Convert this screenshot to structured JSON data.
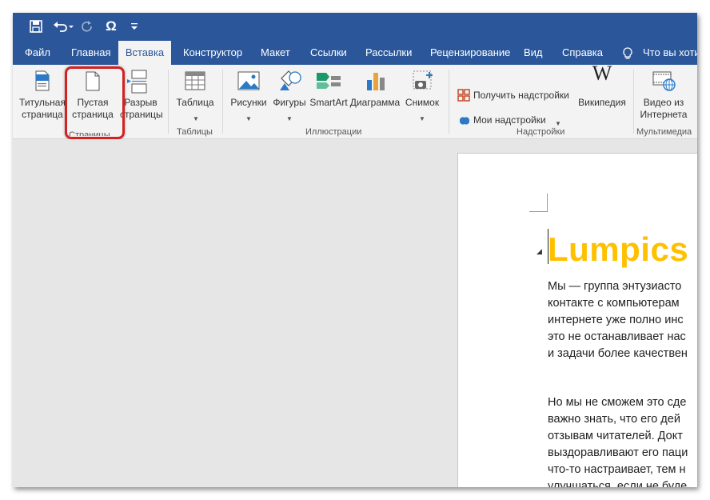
{
  "quick_access": {
    "icons": [
      "save-icon",
      "undo-icon",
      "redo-icon",
      "symbol-icon",
      "customize-icon"
    ],
    "omega_label": "Ω"
  },
  "tabs": [
    {
      "label": "Файл"
    },
    {
      "label": "Главная"
    },
    {
      "label": "Вставка",
      "active": true
    },
    {
      "label": "Конструктор"
    },
    {
      "label": "Макет"
    },
    {
      "label": "Ссылки"
    },
    {
      "label": "Рассылки"
    },
    {
      "label": "Рецензирование"
    },
    {
      "label": "Вид"
    },
    {
      "label": "Справка"
    },
    {
      "label": "Что вы хотит"
    }
  ],
  "ribbon": {
    "pages": {
      "cover_line1": "Титульная",
      "cover_line2": "страница",
      "blank_line1": "Пустая",
      "blank_line2": "страница",
      "break_line1": "Разрыв",
      "break_line2": "страницы",
      "group_label": "Страницы"
    },
    "tables": {
      "table": "Таблица",
      "group_label": "Таблицы"
    },
    "illustrations": {
      "pictures": "Рисунки",
      "shapes": "Фигуры",
      "smartart": "SmartArt",
      "chart": "Диаграмма",
      "screenshot": "Снимок",
      "group_label": "Иллюстрации"
    },
    "addins": {
      "get_addins": "Получить надстройки",
      "my_addins": "Мои надстройки",
      "wikipedia": "Википедия",
      "group_label": "Надстройки"
    },
    "media": {
      "video_line1": "Видео из",
      "video_line2": "Интернета",
      "group_label": "Мультимедиа"
    }
  },
  "document": {
    "heading": "Lumpics",
    "para1": [
      "Мы — группа энтузиасто",
      "контакте с компьютерам",
      "интернете уже полно инс",
      "это не останавливает нас",
      "и задачи более качествен"
    ],
    "para2": [
      "Но мы не сможем это сде",
      "важно знать, что его дей",
      "отзывам читателей. Докт",
      "выздоравливают его паци",
      "что-то настраивает, тем н",
      "улучшаться, если не буде"
    ]
  },
  "colors": {
    "title_bar": "#2b579a",
    "heading": "#ffc000",
    "highlight": "#d42121"
  }
}
